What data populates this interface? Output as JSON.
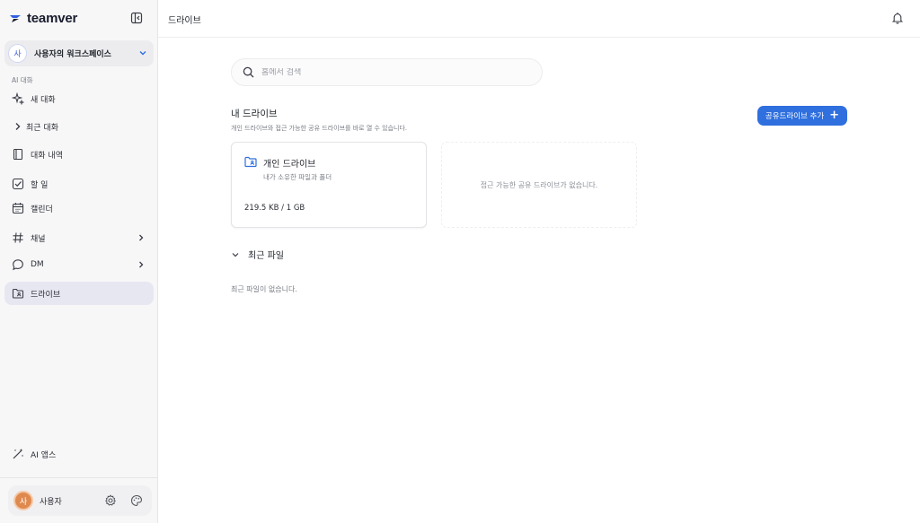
{
  "app": {
    "logo_text": "teamver",
    "page_title": "드라이브"
  },
  "sidebar": {
    "workspace": {
      "avatar_initial": "사",
      "name": "사용자의 워크스페이스"
    },
    "section_label": "AI 대화",
    "items": [
      {
        "label": "새 대화",
        "icon": "sparkle-icon"
      },
      {
        "label": "최근 대화",
        "icon": "chevron-right-icon"
      },
      {
        "label": "대화 내역",
        "icon": "book-icon"
      },
      {
        "label": "할 일",
        "icon": "checkbox-icon"
      },
      {
        "label": "캘린더",
        "icon": "calendar-icon"
      },
      {
        "label": "채널",
        "icon": "hash-icon"
      },
      {
        "label": "DM",
        "icon": "chat-bubble-icon"
      },
      {
        "label": "드라이브",
        "icon": "folder-icon"
      },
      {
        "label": "AI 앱스",
        "icon": "magic-wand-icon"
      }
    ],
    "user": {
      "avatar_initial": "사",
      "name": "사용자"
    }
  },
  "main": {
    "search": {
      "placeholder": "홈에서 검색",
      "value": ""
    },
    "drive": {
      "heading": "내 드라이브",
      "subtitle": "개인 드라이브와 접근 가능한 공유 드라이브를 바로 열 수 있습니다.",
      "add_button_label": "공유드라이브 추가"
    },
    "personal_drive": {
      "title": "개인 드라이브",
      "description": "내가 소유한 파일과 폴더",
      "usage": "219.5 KB / 1 GB"
    },
    "shared_empty_text": "접근 가능한 공유 드라이브가 없습니다.",
    "recent": {
      "label": "최근 파일",
      "empty_text": "최근 파일이 없습니다."
    }
  },
  "colors": {
    "accent": "#2f6fde",
    "active_nav": "#e7e7f2",
    "user_avatar": "#e0894f"
  }
}
